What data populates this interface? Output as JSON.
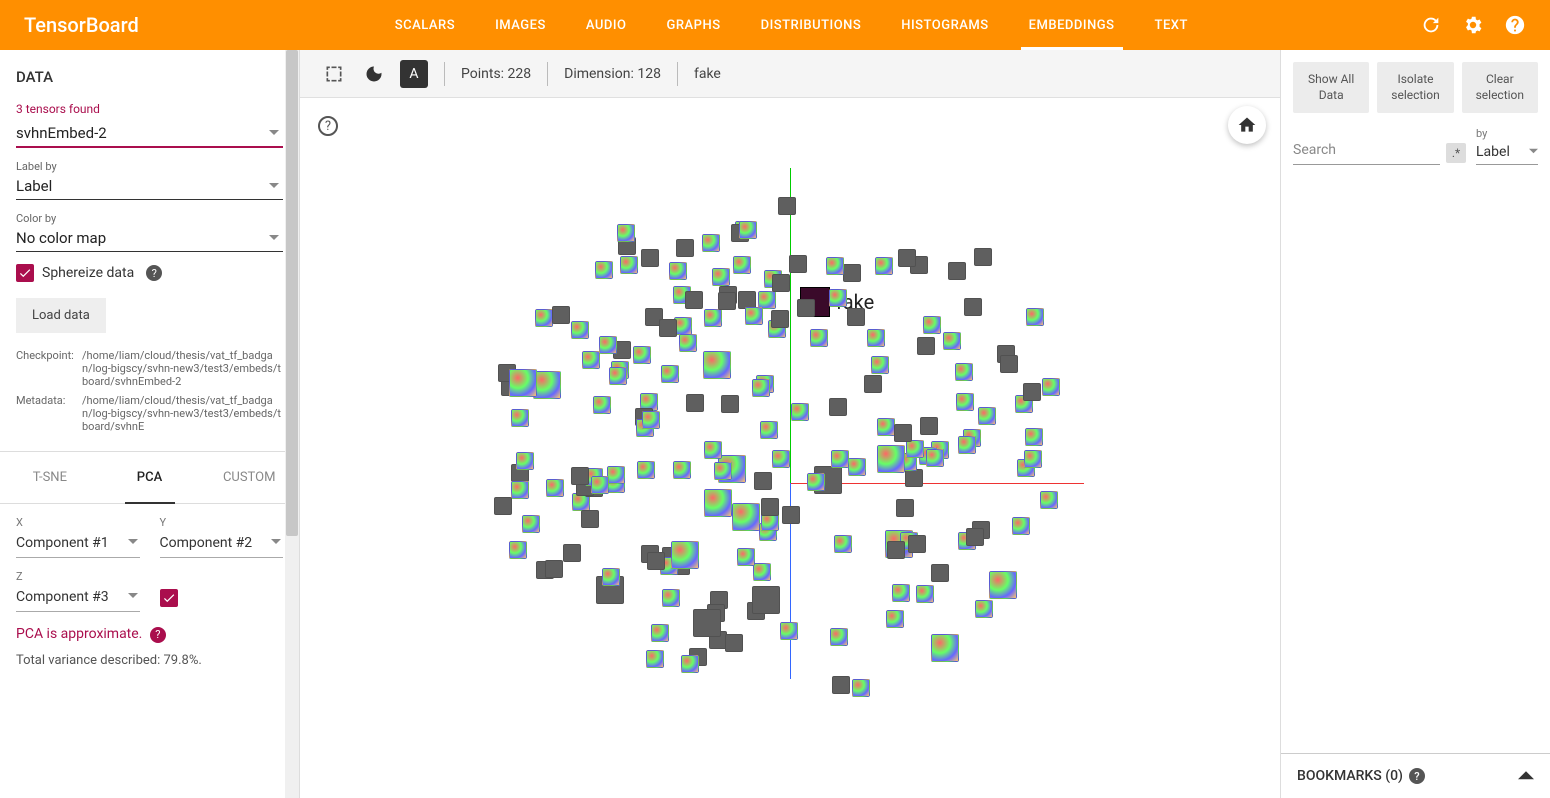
{
  "header": {
    "logo": "TensorBoard"
  },
  "tabs": [
    {
      "label": "SCALARS",
      "active": false
    },
    {
      "label": "IMAGES",
      "active": false
    },
    {
      "label": "AUDIO",
      "active": false
    },
    {
      "label": "GRAPHS",
      "active": false
    },
    {
      "label": "DISTRIBUTIONS",
      "active": false
    },
    {
      "label": "HISTOGRAMS",
      "active": false
    },
    {
      "label": "EMBEDDINGS",
      "active": true
    },
    {
      "label": "TEXT",
      "active": false
    }
  ],
  "left": {
    "title": "DATA",
    "tensors_found": "3 tensors found",
    "tensor_sel": "svhnEmbed-2",
    "label_by_label": "Label by",
    "label_by_value": "Label",
    "color_by_label": "Color by",
    "color_by_value": "No color map",
    "sphereize": "Sphereize data",
    "load_btn": "Load data",
    "checkpoint_key": "Checkpoint:",
    "checkpoint_val": "/home/liam/cloud/thesis/vat_tf_badgan/log-bigscy/svhn-new3/test3/embeds/tboard/svhnEmbed-2",
    "metadata_key": "Metadata:",
    "metadata_val": "/home/liam/cloud/thesis/vat_tf_badgan/log-bigscy/svhn-new3/test3/embeds/tboard/svhnE",
    "proj_tabs": [
      {
        "label": "T-SNE",
        "active": false
      },
      {
        "label": "PCA",
        "active": true
      },
      {
        "label": "CUSTOM",
        "active": false
      }
    ],
    "axis_x_l": "X",
    "axis_x_v": "Component #1",
    "axis_y_l": "Y",
    "axis_y_v": "Component #2",
    "axis_z_l": "Z",
    "axis_z_v": "Component #3",
    "pca_note": "PCA is approximate.",
    "variance": "Total variance described: 79.8%."
  },
  "center": {
    "points": "Points: 228",
    "dimension": "Dimension: 128",
    "selected": "fake",
    "fake_label": "fake"
  },
  "right": {
    "btn1": "Show All Data",
    "btn2": "Isolate selection",
    "btn3": "Clear selection",
    "search_placeholder": "Search",
    "regex": ".*",
    "by_label": "by",
    "by_value": "Label",
    "bookmarks": "BOOKMARKS (0)"
  }
}
